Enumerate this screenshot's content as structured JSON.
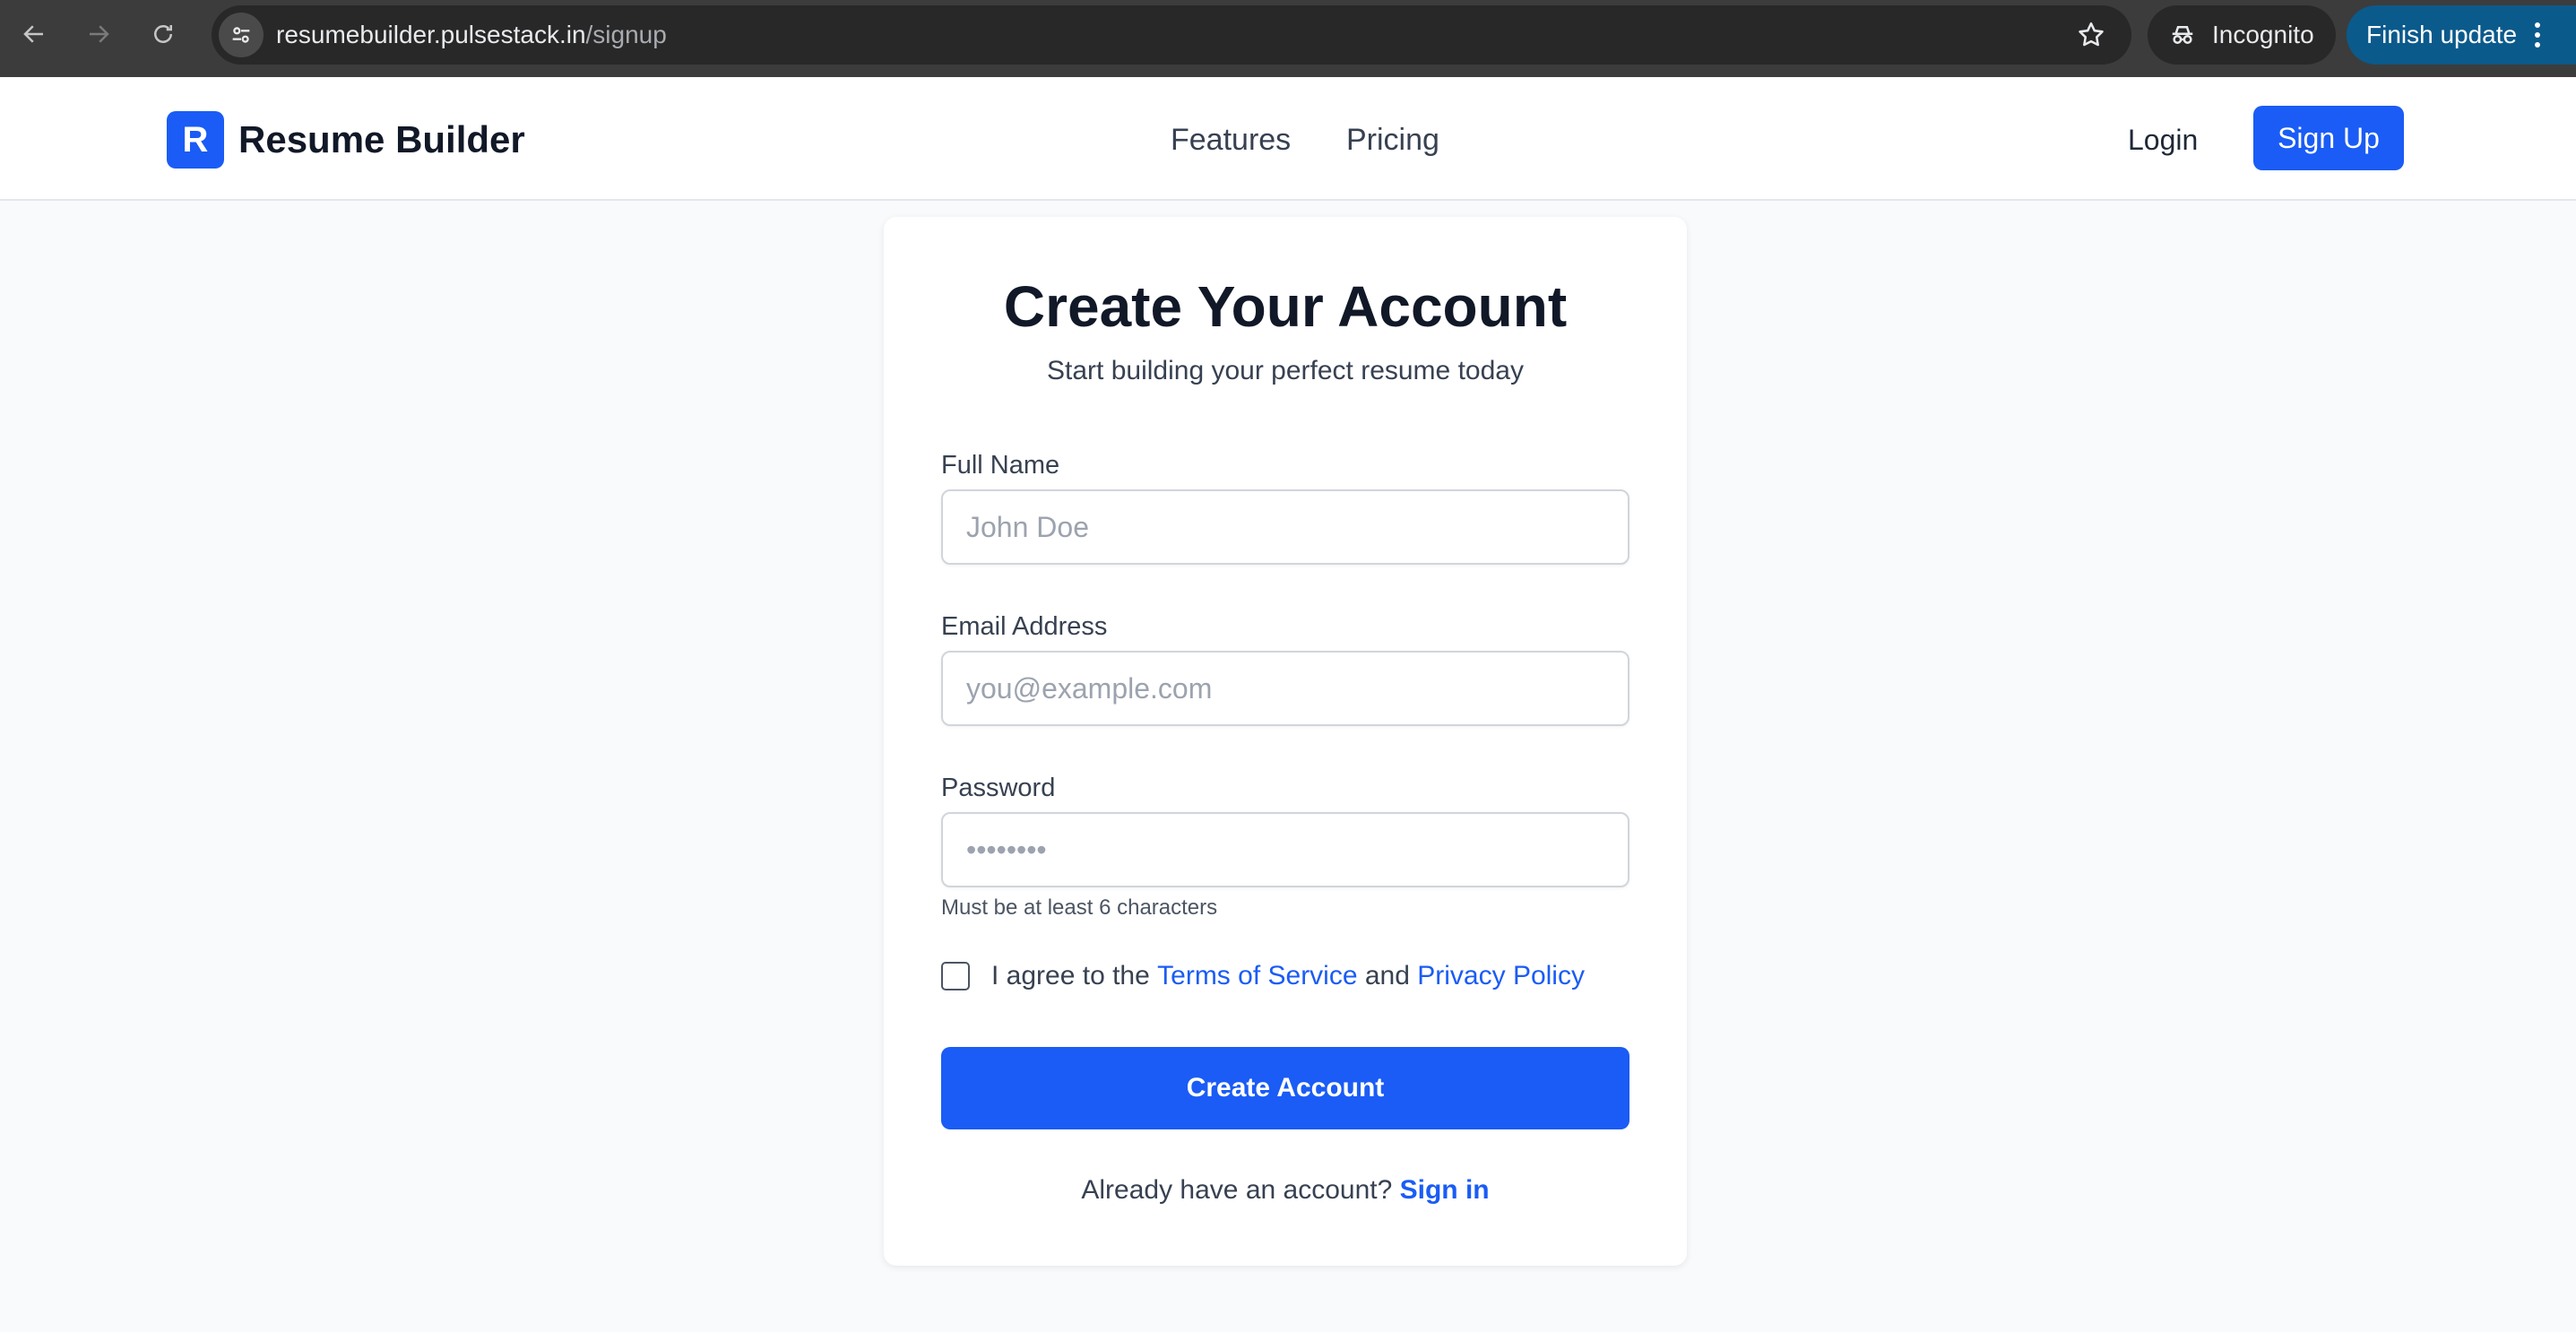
{
  "browser": {
    "url_host": "resumebuilder.pulsestack.in",
    "url_path": "/signup",
    "incognito_label": "Incognito",
    "finish_update_label": "Finish update"
  },
  "header": {
    "logo_letter": "R",
    "brand": "Resume Builder",
    "nav": [
      {
        "label": "Features"
      },
      {
        "label": "Pricing"
      }
    ],
    "login_label": "Login",
    "signup_label": "Sign Up"
  },
  "form": {
    "title": "Create Your Account",
    "subtitle": "Start building your perfect resume today",
    "full_name": {
      "label": "Full Name",
      "placeholder": "John Doe",
      "value": ""
    },
    "email": {
      "label": "Email Address",
      "placeholder": "you@example.com",
      "value": ""
    },
    "password": {
      "label": "Password",
      "placeholder": "••••••••",
      "value": "",
      "hint": "Must be at least 6 characters"
    },
    "agree": {
      "prefix": "I agree to the ",
      "terms": "Terms of Service",
      "middle": " and ",
      "privacy": "Privacy Policy",
      "checked": false
    },
    "submit_label": "Create Account",
    "footer_prefix": "Already have an account? ",
    "footer_link": "Sign in"
  },
  "colors": {
    "accent": "#1a5cf5",
    "page_bg": "#f8fafc",
    "chrome_bg": "#3c3c3c",
    "update_bg": "#0b5a8c"
  }
}
